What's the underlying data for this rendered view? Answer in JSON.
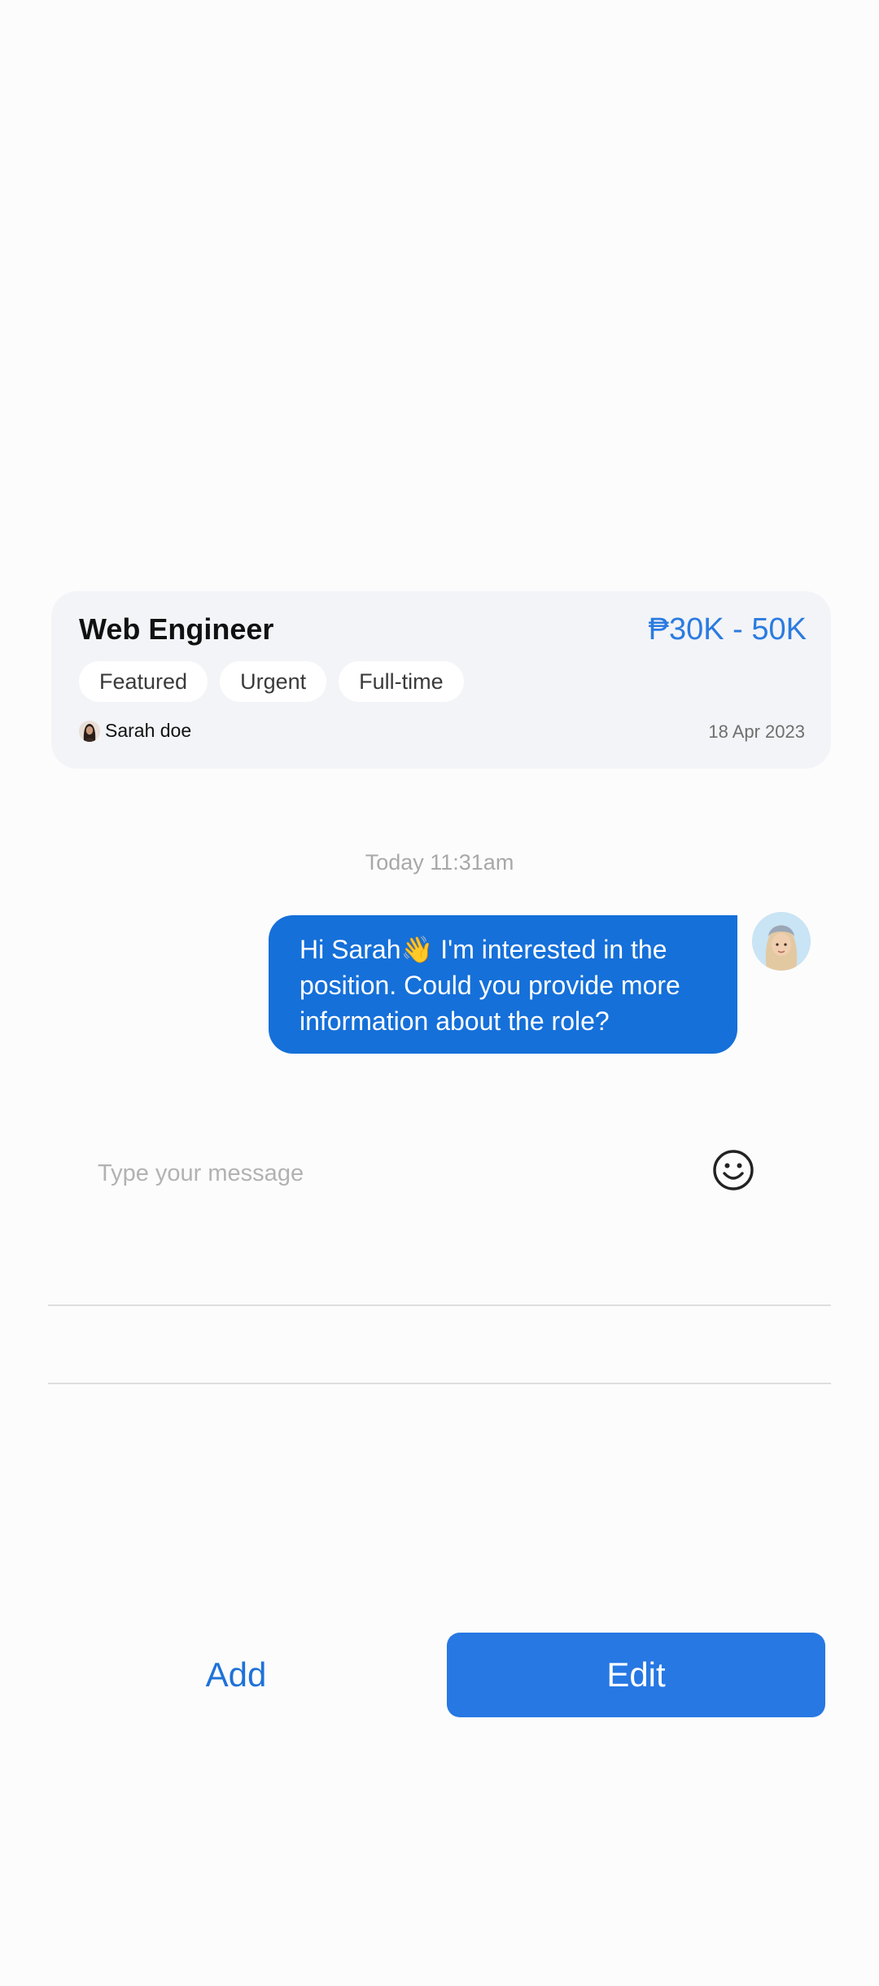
{
  "job": {
    "title": "Web Engineer",
    "salary": "₱30K - 50K",
    "tags": [
      "Featured",
      "Urgent",
      "Full-time"
    ],
    "poster_name": "Sarah doe",
    "date": "18 Apr 2023"
  },
  "chat": {
    "timestamp": "Today 11:31am",
    "messages": [
      {
        "sender": "me",
        "lines": [
          "Hi Sarah👋 I'm interested in the",
          "position. Could you provide more",
          "information about the role?"
        ]
      }
    ]
  },
  "composer": {
    "placeholder": "Type your message",
    "value": "",
    "emoji_icon": "smiley-face-icon"
  },
  "actions": {
    "add_label": "Add",
    "edit_label": "Edit"
  },
  "colors": {
    "accent": "#1570d9",
    "button": "#2778e3",
    "salary": "#2b7be0",
    "card_bg": "#f3f4f7"
  }
}
